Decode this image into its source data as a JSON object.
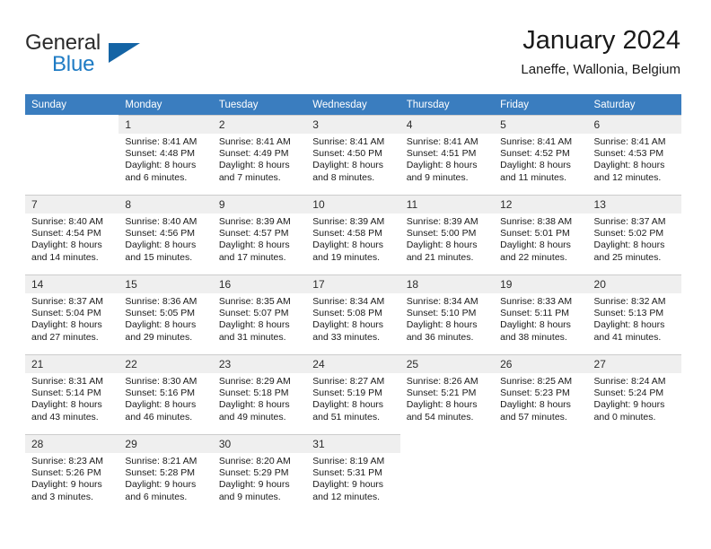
{
  "brand": {
    "name_part1": "General",
    "name_part2": "Blue",
    "triangle_color": "#1464a5",
    "blue_text_color": "#1e7bc4"
  },
  "header": {
    "title": "January 2024",
    "subtitle": "Laneffe, Wallonia, Belgium"
  },
  "theme": {
    "header_row_bg": "#3a7dbf",
    "header_row_text": "#ffffff",
    "daynum_bg": "#efefef",
    "grid_line": "#cccccc"
  },
  "weekday_headers": [
    "Sunday",
    "Monday",
    "Tuesday",
    "Wednesday",
    "Thursday",
    "Friday",
    "Saturday"
  ],
  "weeks": [
    [
      {
        "day": "",
        "sunrise": "",
        "sunset": "",
        "daylight_line1": "",
        "daylight_line2": ""
      },
      {
        "day": "1",
        "sunrise": "Sunrise: 8:41 AM",
        "sunset": "Sunset: 4:48 PM",
        "daylight_line1": "Daylight: 8 hours",
        "daylight_line2": "and 6 minutes."
      },
      {
        "day": "2",
        "sunrise": "Sunrise: 8:41 AM",
        "sunset": "Sunset: 4:49 PM",
        "daylight_line1": "Daylight: 8 hours",
        "daylight_line2": "and 7 minutes."
      },
      {
        "day": "3",
        "sunrise": "Sunrise: 8:41 AM",
        "sunset": "Sunset: 4:50 PM",
        "daylight_line1": "Daylight: 8 hours",
        "daylight_line2": "and 8 minutes."
      },
      {
        "day": "4",
        "sunrise": "Sunrise: 8:41 AM",
        "sunset": "Sunset: 4:51 PM",
        "daylight_line1": "Daylight: 8 hours",
        "daylight_line2": "and 9 minutes."
      },
      {
        "day": "5",
        "sunrise": "Sunrise: 8:41 AM",
        "sunset": "Sunset: 4:52 PM",
        "daylight_line1": "Daylight: 8 hours",
        "daylight_line2": "and 11 minutes."
      },
      {
        "day": "6",
        "sunrise": "Sunrise: 8:41 AM",
        "sunset": "Sunset: 4:53 PM",
        "daylight_line1": "Daylight: 8 hours",
        "daylight_line2": "and 12 minutes."
      }
    ],
    [
      {
        "day": "7",
        "sunrise": "Sunrise: 8:40 AM",
        "sunset": "Sunset: 4:54 PM",
        "daylight_line1": "Daylight: 8 hours",
        "daylight_line2": "and 14 minutes."
      },
      {
        "day": "8",
        "sunrise": "Sunrise: 8:40 AM",
        "sunset": "Sunset: 4:56 PM",
        "daylight_line1": "Daylight: 8 hours",
        "daylight_line2": "and 15 minutes."
      },
      {
        "day": "9",
        "sunrise": "Sunrise: 8:39 AM",
        "sunset": "Sunset: 4:57 PM",
        "daylight_line1": "Daylight: 8 hours",
        "daylight_line2": "and 17 minutes."
      },
      {
        "day": "10",
        "sunrise": "Sunrise: 8:39 AM",
        "sunset": "Sunset: 4:58 PM",
        "daylight_line1": "Daylight: 8 hours",
        "daylight_line2": "and 19 minutes."
      },
      {
        "day": "11",
        "sunrise": "Sunrise: 8:39 AM",
        "sunset": "Sunset: 5:00 PM",
        "daylight_line1": "Daylight: 8 hours",
        "daylight_line2": "and 21 minutes."
      },
      {
        "day": "12",
        "sunrise": "Sunrise: 8:38 AM",
        "sunset": "Sunset: 5:01 PM",
        "daylight_line1": "Daylight: 8 hours",
        "daylight_line2": "and 22 minutes."
      },
      {
        "day": "13",
        "sunrise": "Sunrise: 8:37 AM",
        "sunset": "Sunset: 5:02 PM",
        "daylight_line1": "Daylight: 8 hours",
        "daylight_line2": "and 25 minutes."
      }
    ],
    [
      {
        "day": "14",
        "sunrise": "Sunrise: 8:37 AM",
        "sunset": "Sunset: 5:04 PM",
        "daylight_line1": "Daylight: 8 hours",
        "daylight_line2": "and 27 minutes."
      },
      {
        "day": "15",
        "sunrise": "Sunrise: 8:36 AM",
        "sunset": "Sunset: 5:05 PM",
        "daylight_line1": "Daylight: 8 hours",
        "daylight_line2": "and 29 minutes."
      },
      {
        "day": "16",
        "sunrise": "Sunrise: 8:35 AM",
        "sunset": "Sunset: 5:07 PM",
        "daylight_line1": "Daylight: 8 hours",
        "daylight_line2": "and 31 minutes."
      },
      {
        "day": "17",
        "sunrise": "Sunrise: 8:34 AM",
        "sunset": "Sunset: 5:08 PM",
        "daylight_line1": "Daylight: 8 hours",
        "daylight_line2": "and 33 minutes."
      },
      {
        "day": "18",
        "sunrise": "Sunrise: 8:34 AM",
        "sunset": "Sunset: 5:10 PM",
        "daylight_line1": "Daylight: 8 hours",
        "daylight_line2": "and 36 minutes."
      },
      {
        "day": "19",
        "sunrise": "Sunrise: 8:33 AM",
        "sunset": "Sunset: 5:11 PM",
        "daylight_line1": "Daylight: 8 hours",
        "daylight_line2": "and 38 minutes."
      },
      {
        "day": "20",
        "sunrise": "Sunrise: 8:32 AM",
        "sunset": "Sunset: 5:13 PM",
        "daylight_line1": "Daylight: 8 hours",
        "daylight_line2": "and 41 minutes."
      }
    ],
    [
      {
        "day": "21",
        "sunrise": "Sunrise: 8:31 AM",
        "sunset": "Sunset: 5:14 PM",
        "daylight_line1": "Daylight: 8 hours",
        "daylight_line2": "and 43 minutes."
      },
      {
        "day": "22",
        "sunrise": "Sunrise: 8:30 AM",
        "sunset": "Sunset: 5:16 PM",
        "daylight_line1": "Daylight: 8 hours",
        "daylight_line2": "and 46 minutes."
      },
      {
        "day": "23",
        "sunrise": "Sunrise: 8:29 AM",
        "sunset": "Sunset: 5:18 PM",
        "daylight_line1": "Daylight: 8 hours",
        "daylight_line2": "and 49 minutes."
      },
      {
        "day": "24",
        "sunrise": "Sunrise: 8:27 AM",
        "sunset": "Sunset: 5:19 PM",
        "daylight_line1": "Daylight: 8 hours",
        "daylight_line2": "and 51 minutes."
      },
      {
        "day": "25",
        "sunrise": "Sunrise: 8:26 AM",
        "sunset": "Sunset: 5:21 PM",
        "daylight_line1": "Daylight: 8 hours",
        "daylight_line2": "and 54 minutes."
      },
      {
        "day": "26",
        "sunrise": "Sunrise: 8:25 AM",
        "sunset": "Sunset: 5:23 PM",
        "daylight_line1": "Daylight: 8 hours",
        "daylight_line2": "and 57 minutes."
      },
      {
        "day": "27",
        "sunrise": "Sunrise: 8:24 AM",
        "sunset": "Sunset: 5:24 PM",
        "daylight_line1": "Daylight: 9 hours",
        "daylight_line2": "and 0 minutes."
      }
    ],
    [
      {
        "day": "28",
        "sunrise": "Sunrise: 8:23 AM",
        "sunset": "Sunset: 5:26 PM",
        "daylight_line1": "Daylight: 9 hours",
        "daylight_line2": "and 3 minutes."
      },
      {
        "day": "29",
        "sunrise": "Sunrise: 8:21 AM",
        "sunset": "Sunset: 5:28 PM",
        "daylight_line1": "Daylight: 9 hours",
        "daylight_line2": "and 6 minutes."
      },
      {
        "day": "30",
        "sunrise": "Sunrise: 8:20 AM",
        "sunset": "Sunset: 5:29 PM",
        "daylight_line1": "Daylight: 9 hours",
        "daylight_line2": "and 9 minutes."
      },
      {
        "day": "31",
        "sunrise": "Sunrise: 8:19 AM",
        "sunset": "Sunset: 5:31 PM",
        "daylight_line1": "Daylight: 9 hours",
        "daylight_line2": "and 12 minutes."
      },
      {
        "day": "",
        "sunrise": "",
        "sunset": "",
        "daylight_line1": "",
        "daylight_line2": ""
      },
      {
        "day": "",
        "sunrise": "",
        "sunset": "",
        "daylight_line1": "",
        "daylight_line2": ""
      },
      {
        "day": "",
        "sunrise": "",
        "sunset": "",
        "daylight_line1": "",
        "daylight_line2": ""
      }
    ]
  ]
}
